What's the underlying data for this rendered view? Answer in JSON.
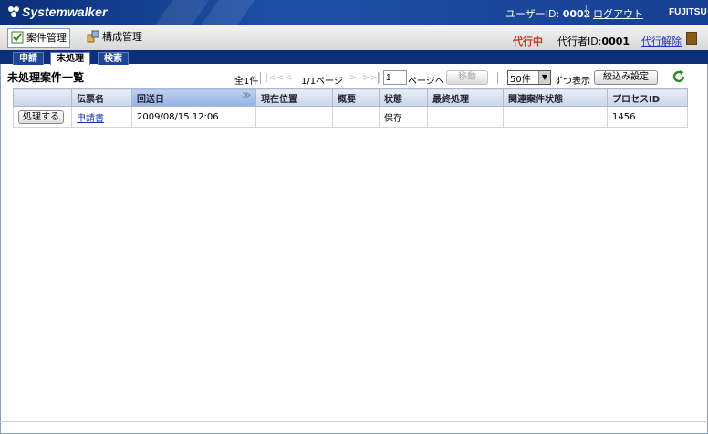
{
  "app": {
    "logo": "Systemwalker",
    "brand": "FUJITSU"
  },
  "header": {
    "user_id_label": "ユーザーID:",
    "user_id": "0002",
    "logout": "ログアウト"
  },
  "menubar": {
    "items": [
      {
        "label": "案件管理",
        "icon": "checklist-icon"
      },
      {
        "label": "構成管理",
        "icon": "config-icon"
      }
    ],
    "proxy_status": "代行中",
    "proxy_id_label": "代行者ID:",
    "proxy_id": "0001",
    "proxy_cancel": "代行解除"
  },
  "tabs": [
    {
      "label": "申請"
    },
    {
      "label": "未処理"
    },
    {
      "label": "検索"
    }
  ],
  "list": {
    "title": "未処理案件一覧",
    "total": "全1件",
    "pager_first": "|<<",
    "pager_prev": "<",
    "pager_info": "1/1ページ",
    "pager_next": ">",
    "pager_last": ">>|",
    "page_input": "1",
    "page_to": "ページへ",
    "move_button": "移動",
    "per_page_value": "50件",
    "per_page_label": "ずつ表示",
    "filter_button": "絞込み設定"
  },
  "table": {
    "columns": [
      "",
      "伝票名",
      "回送日",
      "現在位置",
      "概要",
      "状態",
      "最終処理",
      "関連案件状態",
      "プロセスID"
    ],
    "rows": [
      {
        "action": "処理する",
        "form": "申請書",
        "date": "2009/08/15 12:06",
        "location": "",
        "summary": "",
        "status": "保存",
        "last": "",
        "related": "",
        "process_id": "1456"
      }
    ]
  },
  "colors": {
    "header_bg": "#1d4fa6",
    "tab_bg": "#0d2f7a",
    "proxy_red": "#c0392b",
    "link": "#1a33b8"
  }
}
